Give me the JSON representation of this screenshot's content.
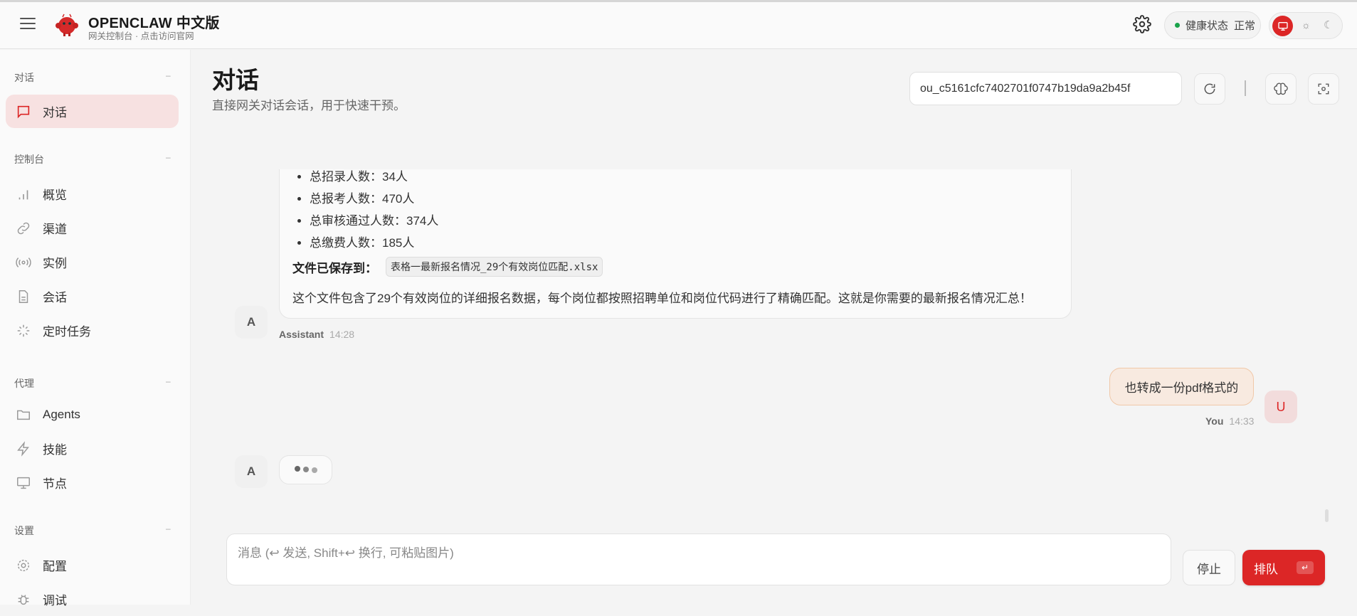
{
  "header": {
    "brand": "OPENCLAW 中文版",
    "subtitle": "网关控制台 · 点击访问官网",
    "health_label": "健康状态",
    "health_value": "正常",
    "health_color": "#1aa34a",
    "accent": "#dc2626"
  },
  "sidebar": {
    "sections": [
      {
        "label": "对话",
        "items": [
          {
            "label": "对话",
            "icon": "message-icon",
            "active": true
          }
        ]
      },
      {
        "label": "控制台",
        "items": [
          {
            "label": "概览",
            "icon": "bar-chart-icon"
          },
          {
            "label": "渠道",
            "icon": "link-icon"
          },
          {
            "label": "实例",
            "icon": "radio-icon"
          },
          {
            "label": "会话",
            "icon": "file-icon"
          },
          {
            "label": "定时任务",
            "icon": "loader-icon"
          }
        ]
      },
      {
        "label": "代理",
        "items": [
          {
            "label": "Agents",
            "icon": "folder-icon"
          },
          {
            "label": "技能",
            "icon": "zap-icon"
          },
          {
            "label": "节点",
            "icon": "monitor-icon"
          }
        ]
      },
      {
        "label": "设置",
        "items": [
          {
            "label": "配置",
            "icon": "gear-icon"
          },
          {
            "label": "调试",
            "icon": "bug-icon"
          }
        ]
      }
    ],
    "collapse": "–"
  },
  "page": {
    "title": "对话",
    "subtitle": "直接网关对话会话，用于快速干预。",
    "session_key": "ou_c5161cfc7402701f0747b19da9a2b45f"
  },
  "messages": {
    "assistant1": {
      "bullets": [
        "总招录人数：34人",
        "总报考人数：470人",
        "总审核通过人数：374人",
        "总缴费人数：185人"
      ],
      "saved_label": "文件已保存到：",
      "saved_file": "表格一最新报名情况_29个有效岗位匹配.xlsx",
      "paragraph": "这个文件包含了29个有效岗位的详细报名数据，每个岗位都按照招聘单位和岗位代码进行了精确匹配。这就是你需要的最新报名情况汇总！",
      "avatar": "A",
      "sender": "Assistant",
      "time": "14:28"
    },
    "user1": {
      "text": "也转成一份pdf格式的",
      "avatar": "U",
      "sender": "You",
      "time": "14:33"
    },
    "typing": {
      "avatar": "A"
    }
  },
  "composer": {
    "placeholder": "消息 (↩ 发送, Shift+↩ 换行, 可粘贴图片)",
    "stop": "停止",
    "queue": "排队",
    "queue_kbd": "↵"
  }
}
